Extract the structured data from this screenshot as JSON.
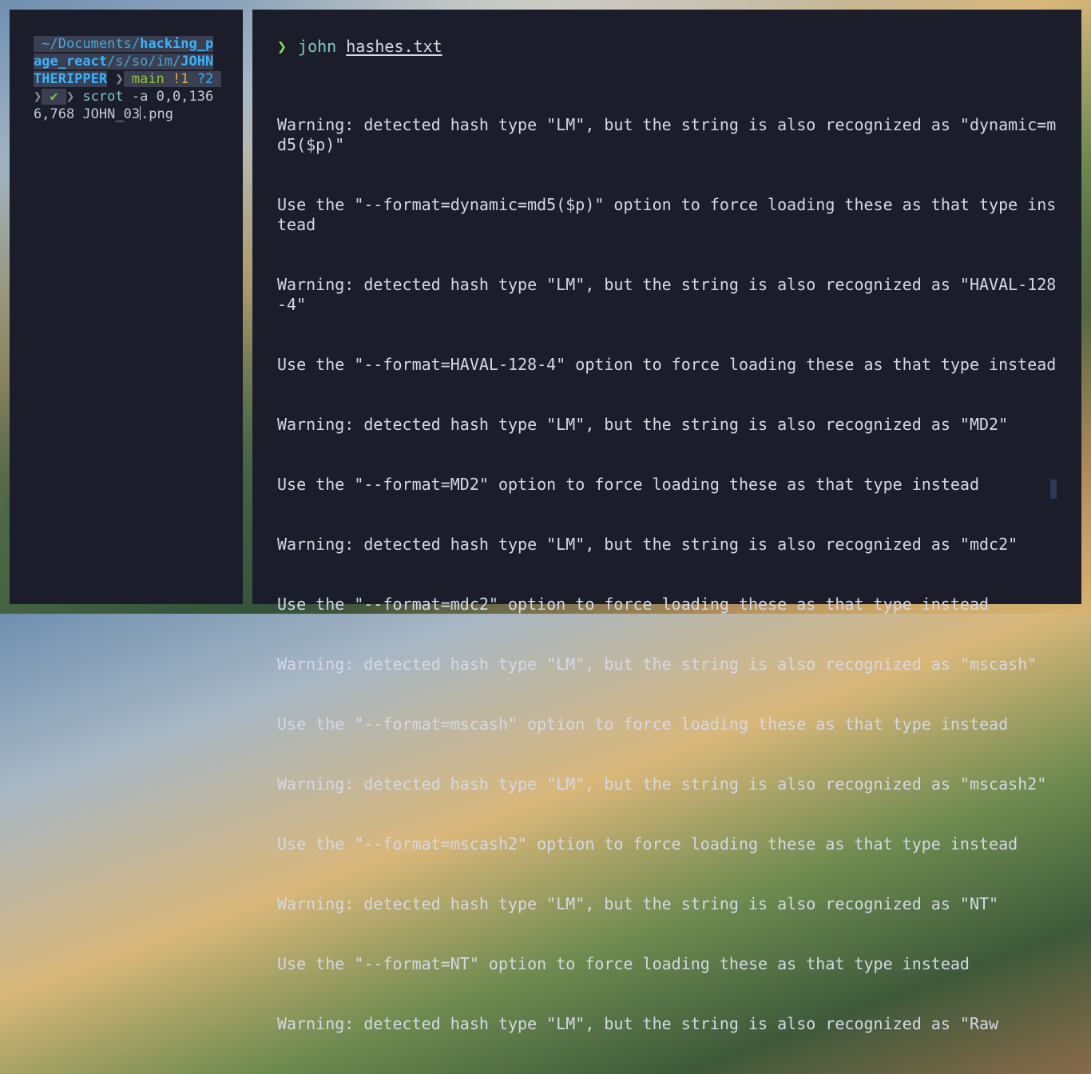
{
  "left_pane": {
    "path_prefix": " ~/Documents/",
    "path_bold_1": "hacking_",
    "path_bold_2": "page_react",
    "path_mid": "/s/so/im/",
    "path_bold_3": "JOHNTHERIPPER",
    "git_branch": " main ",
    "git_dirty": "!1",
    "git_untracked": " ?2 ",
    "status_check": " ✔ ",
    "command": " scrot",
    "args_before_cursor": " -a 0,0,1366,768 JOHN_03",
    "args_after_cursor": ".png"
  },
  "right_pane": {
    "prompt_symbol": "❯",
    "command": "john",
    "argument": "hashes.txt",
    "output_lines": [
      "Warning: detected hash type \"LM\", but the string is also recognized as \"dynamic=md5($p)\"",
      "Use the \"--format=dynamic=md5($p)\" option to force loading these as that type instead",
      "Warning: detected hash type \"LM\", but the string is also recognized as \"HAVAL-128-4\"",
      "Use the \"--format=HAVAL-128-4\" option to force loading these as that type instead",
      "Warning: detected hash type \"LM\", but the string is also recognized as \"MD2\"",
      "Use the \"--format=MD2\" option to force loading these as that type instead",
      "Warning: detected hash type \"LM\", but the string is also recognized as \"mdc2\"",
      "Use the \"--format=mdc2\" option to force loading these as that type instead",
      "Warning: detected hash type \"LM\", but the string is also recognized as \"mscash\"",
      "Use the \"--format=mscash\" option to force loading these as that type instead",
      "Warning: detected hash type \"LM\", but the string is also recognized as \"mscash2\"",
      "Use the \"--format=mscash2\" option to force loading these as that type instead",
      "Warning: detected hash type \"LM\", but the string is also recognized as \"NT\"",
      "Use the \"--format=NT\" option to force loading these as that type instead",
      "Warning: detected hash type \"LM\", but the string is also recognized as \"Raw"
    ]
  },
  "colors": {
    "terminal_bg": "#1b1d2a",
    "text": "#d5d8e6",
    "prompt_arrow": "#7ee04a",
    "path_blue": "#39b3ff"
  }
}
